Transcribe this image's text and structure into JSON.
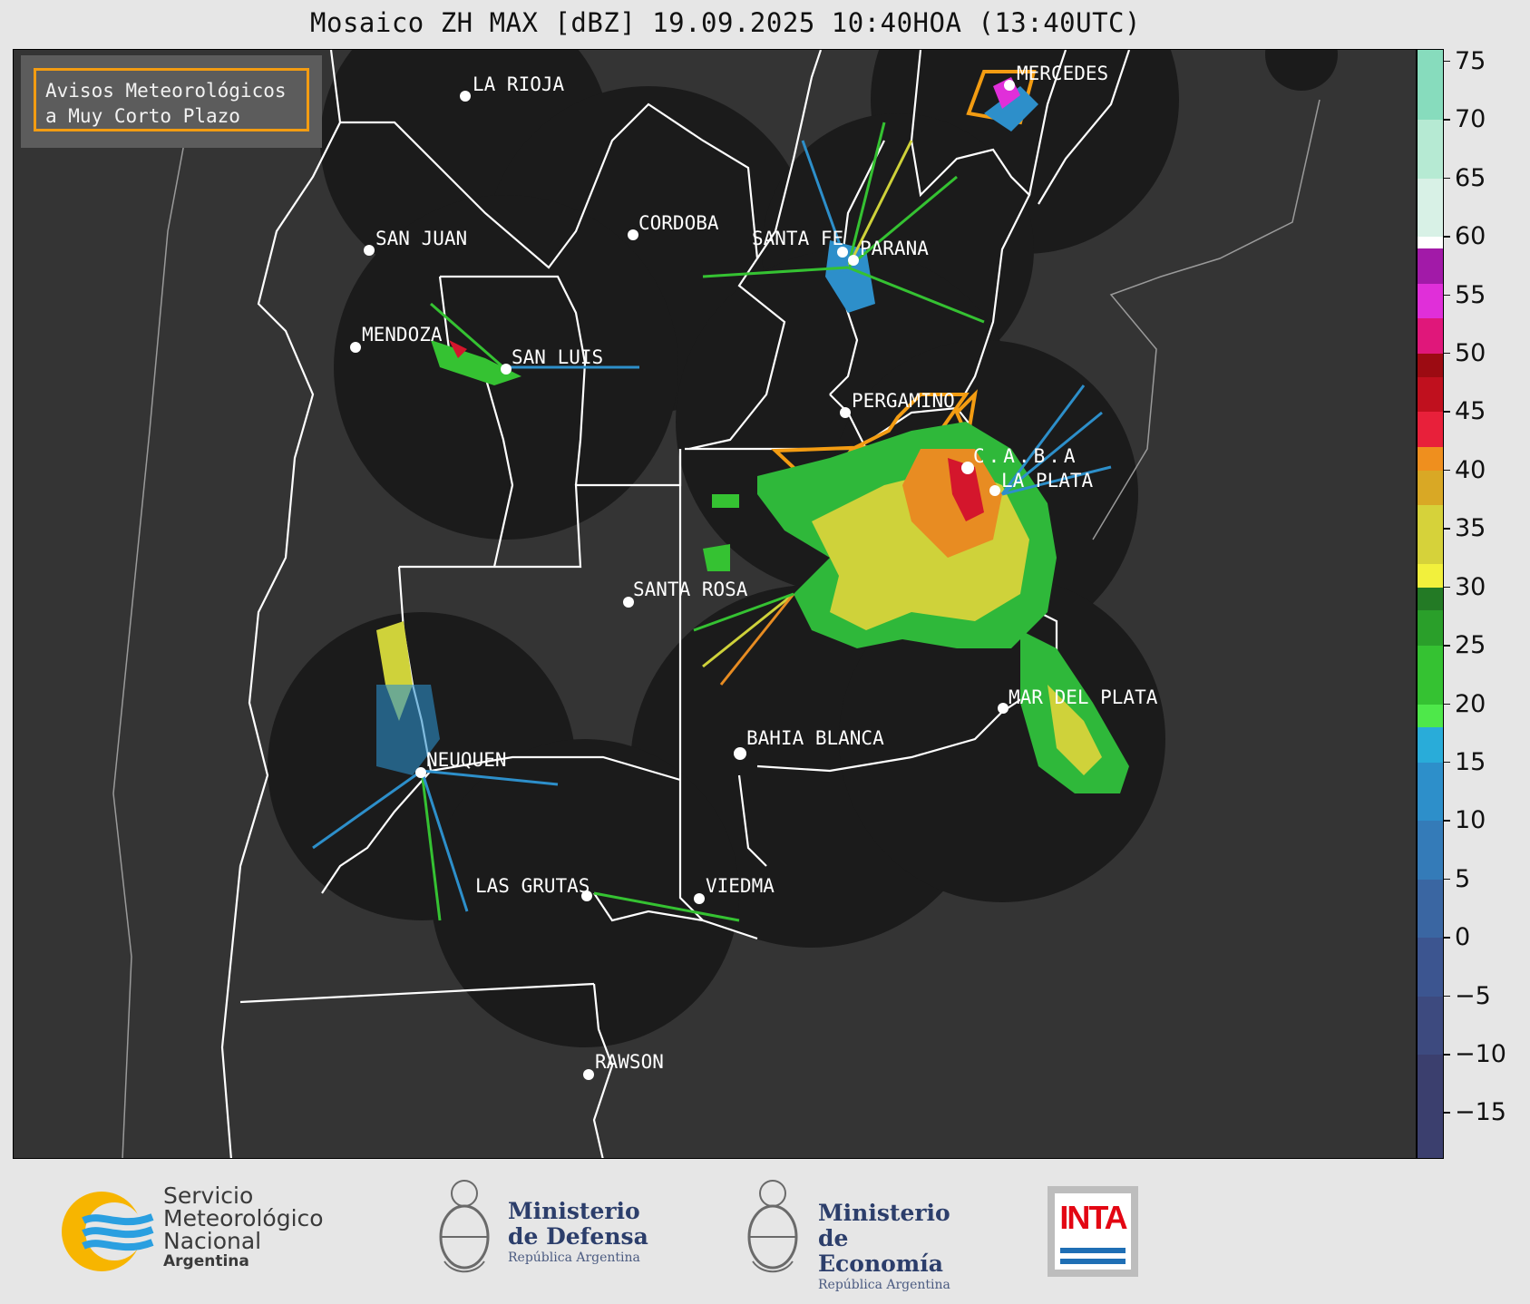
{
  "title": "Mosaico ZH MAX [dBZ] 19.09.2025 10:40HOA (13:40UTC)",
  "legend": {
    "line1": "Avisos Meteorológicos",
    "line2": "a Muy Corto Plazo",
    "border_color": "#f39c12"
  },
  "cities": [
    {
      "name": "LA RIOJA"
    },
    {
      "name": "MERCEDES"
    },
    {
      "name": "SAN JUAN"
    },
    {
      "name": "CORDOBA"
    },
    {
      "name": "SANTA FE"
    },
    {
      "name": "PARANA"
    },
    {
      "name": "MENDOZA"
    },
    {
      "name": "SAN LUIS"
    },
    {
      "name": "PERGAMINO"
    },
    {
      "name": "C.A.B.A"
    },
    {
      "name": "LA PLATA"
    },
    {
      "name": "SANTA ROSA"
    },
    {
      "name": "MAR DEL PLATA"
    },
    {
      "name": "BAHIA BLANCA"
    },
    {
      "name": "NEUQUEN"
    },
    {
      "name": "LAS GRUTAS"
    },
    {
      "name": "VIEDMA"
    },
    {
      "name": "RAWSON"
    }
  ],
  "colorbar": {
    "unit": "dBZ",
    "min": -19,
    "max": 76,
    "ticks": [
      75,
      70,
      65,
      60,
      55,
      50,
      45,
      40,
      35,
      30,
      25,
      20,
      15,
      10,
      5,
      0,
      -5,
      -10,
      -15
    ],
    "tick_labels": [
      "75",
      "70",
      "65",
      "60",
      "55",
      "50",
      "45",
      "40",
      "35",
      "30",
      "25",
      "20",
      "15",
      "10",
      "5",
      "0",
      "−5",
      "−10",
      "−15"
    ],
    "bands": [
      {
        "from": -19,
        "to": -10,
        "color": "#3b3f6e"
      },
      {
        "from": -10,
        "to": -5,
        "color": "#3d4a7f"
      },
      {
        "from": -5,
        "to": 0,
        "color": "#3c5590"
      },
      {
        "from": 0,
        "to": 5,
        "color": "#3a66a2"
      },
      {
        "from": 5,
        "to": 10,
        "color": "#347bb8"
      },
      {
        "from": 10,
        "to": 15,
        "color": "#2d8fca"
      },
      {
        "from": 15,
        "to": 18,
        "color": "#29acd9"
      },
      {
        "from": 18,
        "to": 20,
        "color": "#4ee84a"
      },
      {
        "from": 20,
        "to": 25,
        "color": "#35c232"
      },
      {
        "from": 25,
        "to": 28,
        "color": "#2a9f2a"
      },
      {
        "from": 28,
        "to": 30,
        "color": "#237a25"
      },
      {
        "from": 30,
        "to": 32,
        "color": "#f2f03c"
      },
      {
        "from": 32,
        "to": 37,
        "color": "#d6d23a"
      },
      {
        "from": 37,
        "to": 40,
        "color": "#d9a825"
      },
      {
        "from": 40,
        "to": 42,
        "color": "#ef8f1e"
      },
      {
        "from": 42,
        "to": 45,
        "color": "#e8203a"
      },
      {
        "from": 45,
        "to": 48,
        "color": "#c0101e"
      },
      {
        "from": 48,
        "to": 50,
        "color": "#9c0b12"
      },
      {
        "from": 50,
        "to": 53,
        "color": "#e0177a"
      },
      {
        "from": 53,
        "to": 56,
        "color": "#e02fd9"
      },
      {
        "from": 56,
        "to": 59,
        "color": "#a21aa8"
      },
      {
        "from": 59,
        "to": 60,
        "color": "#ffffff"
      },
      {
        "from": 60,
        "to": 65,
        "color": "#d8f1e6"
      },
      {
        "from": 65,
        "to": 70,
        "color": "#b6ead3"
      },
      {
        "from": 70,
        "to": 76,
        "color": "#87dcbd"
      }
    ]
  },
  "footer": {
    "smn": {
      "line1": "Servicio",
      "line2": "Meteorológico",
      "line3": "Nacional",
      "line4": "Argentina"
    },
    "defensa": {
      "line1": "Ministerio",
      "line2": "de Defensa",
      "line3": "República Argentina"
    },
    "economia": {
      "line1": "Ministerio",
      "line2": "de Economía",
      "line3": "República Argentina"
    },
    "inta": {
      "label": "INTA"
    }
  }
}
